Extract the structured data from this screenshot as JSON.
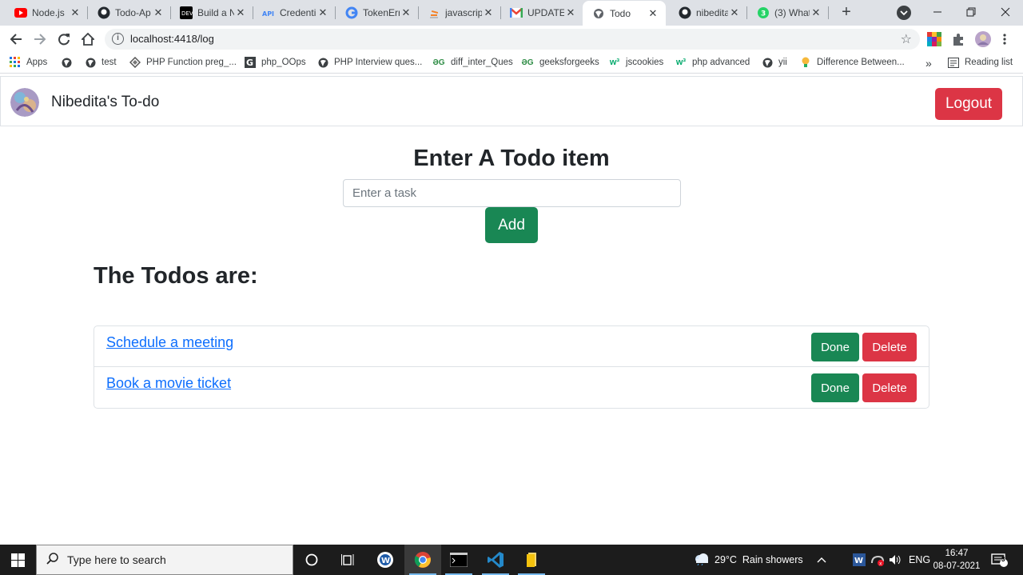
{
  "browser": {
    "tabs": [
      {
        "title": "Node.js",
        "icon": "youtube-icon",
        "active": false
      },
      {
        "title": "Todo-Ap",
        "icon": "github-icon",
        "active": false
      },
      {
        "title": "Build a N",
        "icon": "dev-icon",
        "active": false
      },
      {
        "title": "Credenti",
        "icon": "api-icon",
        "active": false
      },
      {
        "title": "TokenErr",
        "icon": "google-icon",
        "active": false
      },
      {
        "title": "javascrip",
        "icon": "stackoverflow-icon",
        "active": false
      },
      {
        "title": "UPDATE:",
        "icon": "gmail-icon",
        "active": false
      },
      {
        "title": "Todo",
        "icon": "globe-icon",
        "active": true
      },
      {
        "title": "nibedita",
        "icon": "github-icon",
        "active": false
      },
      {
        "title": "(3) What",
        "icon": "whatsapp-icon",
        "active": false
      }
    ],
    "url": "localhost:4418/log",
    "bookmarks": [
      {
        "label": "Apps",
        "icon": "apps-grid-icon"
      },
      {
        "label": "",
        "icon": "globe-icon"
      },
      {
        "label": "test",
        "icon": "globe-icon"
      },
      {
        "label": "PHP Function preg_...",
        "icon": "diamond-icon"
      },
      {
        "label": "php_OOps",
        "icon": "g-logo-icon"
      },
      {
        "label": "PHP Interview ques...",
        "icon": "globe-icon"
      },
      {
        "label": "diff_inter_Ques",
        "icon": "gfg-icon"
      },
      {
        "label": "geeksforgeeks",
        "icon": "gfg-icon"
      },
      {
        "label": "jscookies",
        "icon": "w3-icon"
      },
      {
        "label": "php advanced",
        "icon": "w3-icon"
      },
      {
        "label": "yii",
        "icon": "globe-icon"
      },
      {
        "label": "Difference Between...",
        "icon": "bulb-icon"
      }
    ],
    "reading_list": "Reading list"
  },
  "app": {
    "brand": "Nibedita's To-do",
    "logout_label": "Logout",
    "heading": "Enter A Todo item",
    "input_placeholder": "Enter a task",
    "input_value": "",
    "add_label": "Add",
    "list_heading": "The Todos are:",
    "todos": [
      {
        "text": "Schedule a meeting",
        "done_label": "Done",
        "delete_label": "Delete"
      },
      {
        "text": "Book a movie ticket",
        "done_label": "Done",
        "delete_label": "Delete"
      }
    ]
  },
  "taskbar": {
    "search_placeholder": "Type here to search",
    "weather": "29°C  Rain showers",
    "language": "ENG",
    "time": "16:47",
    "date": "08-07-2021",
    "notification_count": "3"
  },
  "colors": {
    "success": "#198754",
    "danger": "#dc3545",
    "link": "#0d6efd"
  }
}
